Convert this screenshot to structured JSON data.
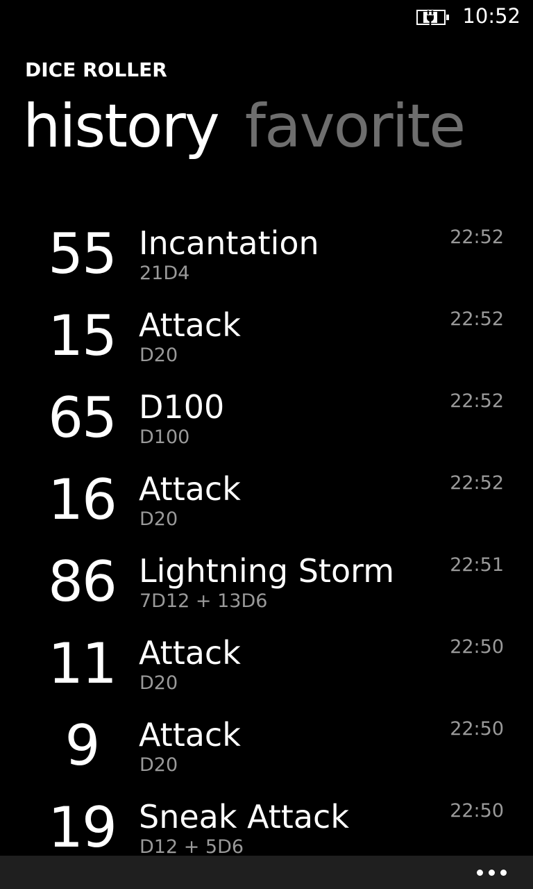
{
  "status_bar": {
    "battery_icon": "battery-charging-icon",
    "time": "10:52"
  },
  "app": {
    "title": "DICE ROLLER"
  },
  "pivot": {
    "active": "history",
    "inactive": "favorite"
  },
  "history": [
    {
      "total": "55",
      "name": "Incantation",
      "dice": "21D4",
      "time": "22:52"
    },
    {
      "total": "15",
      "name": "Attack",
      "dice": "D20",
      "time": "22:52"
    },
    {
      "total": "65",
      "name": "D100",
      "dice": "D100",
      "time": "22:52"
    },
    {
      "total": "16",
      "name": "Attack",
      "dice": "D20",
      "time": "22:52"
    },
    {
      "total": "86",
      "name": "Lightning Storm",
      "dice": "7D12 + 13D6",
      "time": "22:51"
    },
    {
      "total": "11",
      "name": "Attack",
      "dice": "D20",
      "time": "22:50"
    },
    {
      "total": "9",
      "name": "Attack",
      "dice": "D20",
      "time": "22:50"
    },
    {
      "total": "19",
      "name": "Sneak Attack",
      "dice": "D12 + 5D6",
      "time": "22:50"
    }
  ],
  "app_bar": {
    "more_icon": "more-ellipsis-icon"
  }
}
